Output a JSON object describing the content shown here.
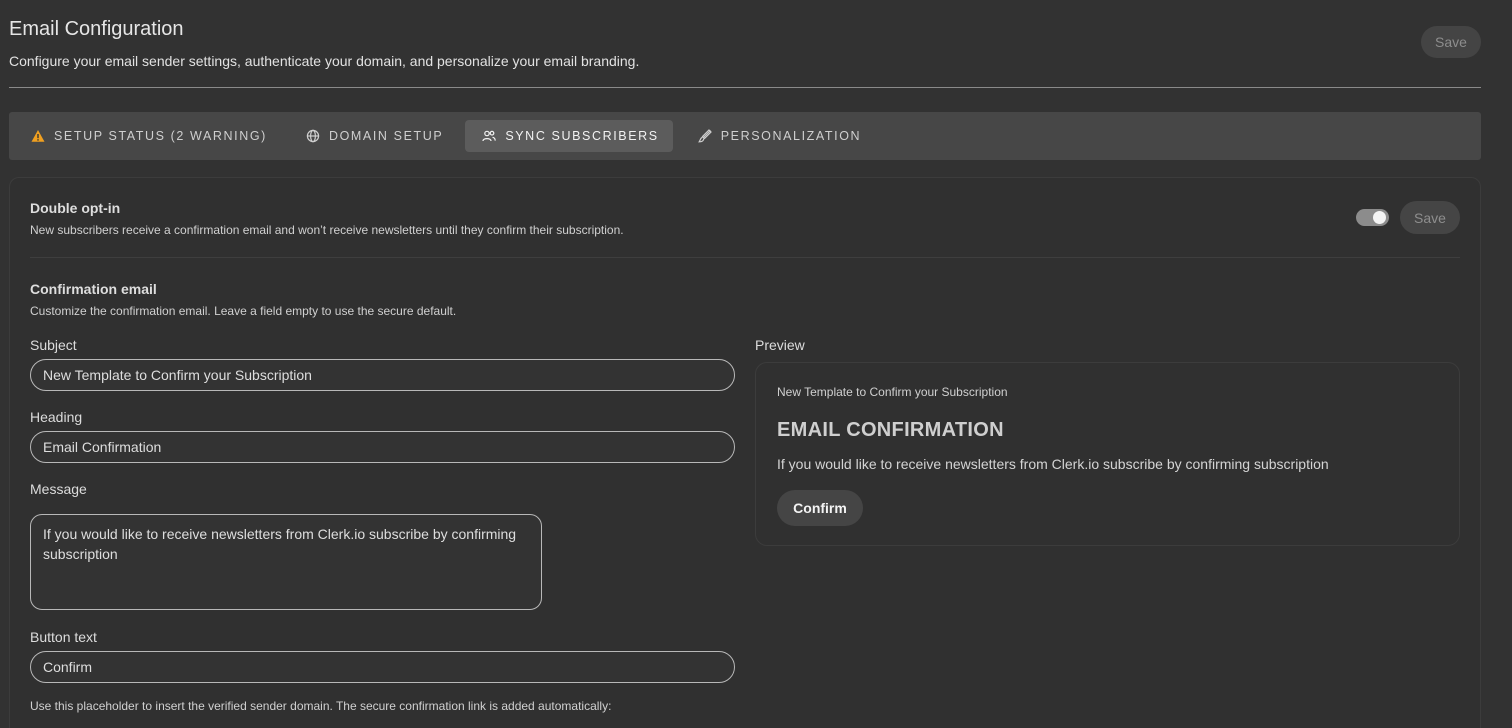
{
  "header": {
    "title": "Email Configuration",
    "subtitle": "Configure your email sender settings, authenticate your domain, and personalize your email branding.",
    "save_label": "Save"
  },
  "tabs": [
    {
      "label": "Setup Status (2 warning)",
      "icon": "warning-icon",
      "icon_color": "#f0a020",
      "active": false
    },
    {
      "label": "Domain Setup",
      "icon": "globe-icon",
      "active": false
    },
    {
      "label": "Sync Subscribers",
      "icon": "users-icon",
      "active": true
    },
    {
      "label": "Personalization",
      "icon": "brush-icon",
      "active": false
    }
  ],
  "double_opt_in": {
    "title": "Double opt-in",
    "description": "New subscribers receive a confirmation email and won’t receive newsletters until they confirm their subscription.",
    "enabled": true,
    "save_label": "Save"
  },
  "confirmation": {
    "title": "Confirmation email",
    "description": "Customize the confirmation email. Leave a field empty to use the secure default.",
    "subject_label": "Subject",
    "subject_value": "New Template to Confirm your Subscription",
    "heading_label": "Heading",
    "heading_value": "Email Confirmation",
    "message_label": "Message",
    "message_value": "If you would like to receive newsletters from Clerk.io subscribe by confirming subscription",
    "button_label": "Button text",
    "button_value": "Confirm",
    "hint": "Use this placeholder to insert the verified sender domain. The secure confirmation link is added automatically:"
  },
  "preview": {
    "label": "Preview",
    "subject": "New Template to Confirm your Subscription",
    "heading": "EMAIL CONFIRMATION",
    "message": "If you would like to receive newsletters from Clerk.io subscribe by confirming subscription",
    "button": "Confirm"
  }
}
